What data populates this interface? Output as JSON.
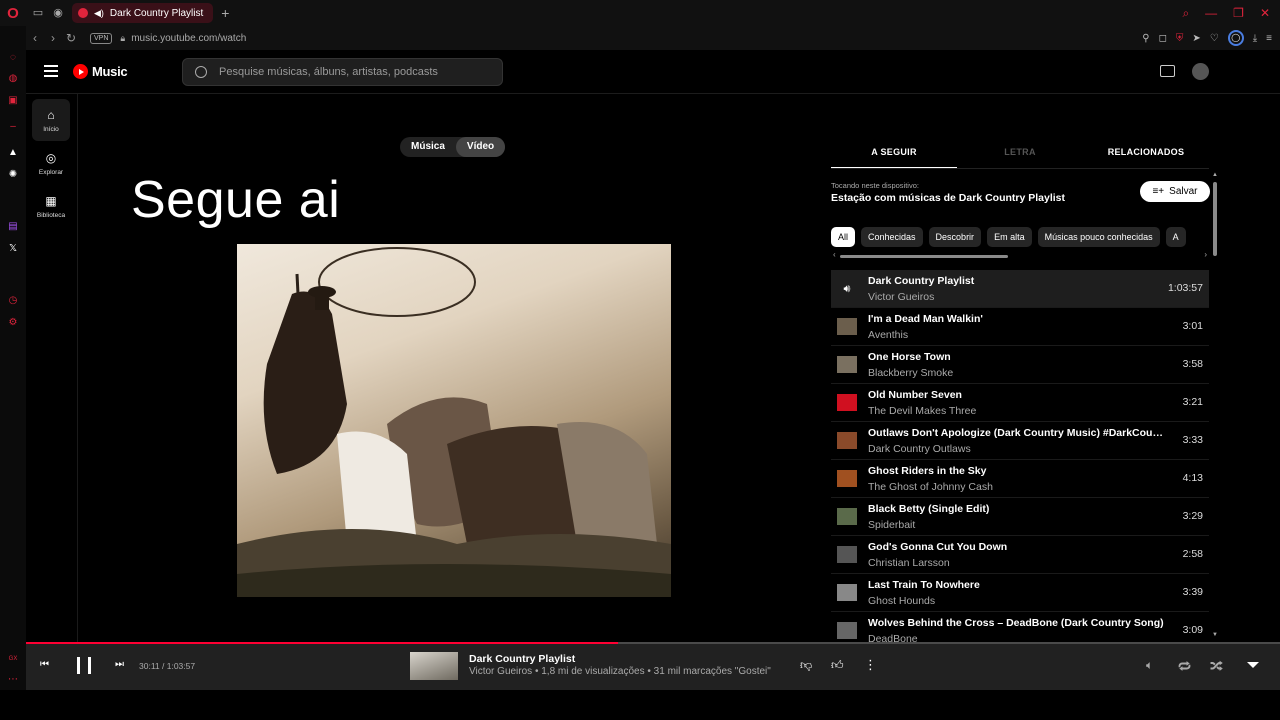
{
  "browser": {
    "tab_title": "Dark Country Playlist",
    "new_tab": "+",
    "vpn_badge": "VPN",
    "url": "music.youtube.com/watch",
    "accent": "#e0243c"
  },
  "header": {
    "logo_text": "Music",
    "search_placeholder": "Pesquise músicas, álbuns, artistas, podcasts"
  },
  "nav": {
    "items": [
      {
        "label": "Início",
        "icon": "home-icon"
      },
      {
        "label": "Explorar",
        "icon": "compass-icon"
      },
      {
        "label": "Biblioteca",
        "icon": "library-icon"
      }
    ]
  },
  "player": {
    "toggle_music": "Música",
    "toggle_video": "Vídeo",
    "overlay_text": "Segue ai"
  },
  "panel": {
    "tabs": [
      "A SEGUIR",
      "LETRA",
      "RELACIONADOS"
    ],
    "playing_on": "Tocando neste dispositivo:",
    "station": "Estação com músicas de Dark Country Playlist",
    "save_label": "Salvar",
    "chips": [
      "All",
      "Conhecidas",
      "Descobrir",
      "Em alta",
      "Músicas pouco conhecidas",
      "A"
    ]
  },
  "queue": [
    {
      "title": "Dark Country Playlist",
      "artist": "Victor Gueiros",
      "duration": "1:03:57",
      "playing": true,
      "thumb": "#111111"
    },
    {
      "title": "I'm a Dead Man Walkin'",
      "artist": "Aventhis",
      "duration": "3:01",
      "playing": false,
      "thumb": "#6b5e4c"
    },
    {
      "title": "One Horse Town",
      "artist": "Blackberry Smoke",
      "duration": "3:58",
      "playing": false,
      "thumb": "#7a7060"
    },
    {
      "title": "Old Number Seven",
      "artist": "The Devil Makes Three",
      "duration": "3:21",
      "playing": false,
      "thumb": "#d01020"
    },
    {
      "title": "Outlaws Don't Apologize (Dark Country Music) #DarkCountry...",
      "artist": "Dark Country Outlaws",
      "duration": "3:33",
      "playing": false,
      "thumb": "#8a4a2a"
    },
    {
      "title": "Ghost Riders in the Sky",
      "artist": "The Ghost of Johnny Cash",
      "duration": "4:13",
      "playing": false,
      "thumb": "#a05020"
    },
    {
      "title": "Black Betty (Single Edit)",
      "artist": "Spiderbait",
      "duration": "3:29",
      "playing": false,
      "thumb": "#5a6a4a"
    },
    {
      "title": "God's Gonna Cut You Down",
      "artist": "Christian Larsson",
      "duration": "2:58",
      "playing": false,
      "thumb": "#555555"
    },
    {
      "title": "Last Train To Nowhere",
      "artist": "Ghost Hounds",
      "duration": "3:39",
      "playing": false,
      "thumb": "#888888"
    },
    {
      "title": "Wolves Behind the Cross – DeadBone (Dark Country Song)",
      "artist": "DeadBone",
      "duration": "3:09",
      "playing": false,
      "thumb": "#666666"
    }
  ],
  "playerbar": {
    "time": "30:11 / 1:03:57",
    "progress": 0.472,
    "title": "Dark Country Playlist",
    "subtitle": "Victor Gueiros • 1,8 mi de visualizações • 31 mil marcações \"Gostei\""
  }
}
